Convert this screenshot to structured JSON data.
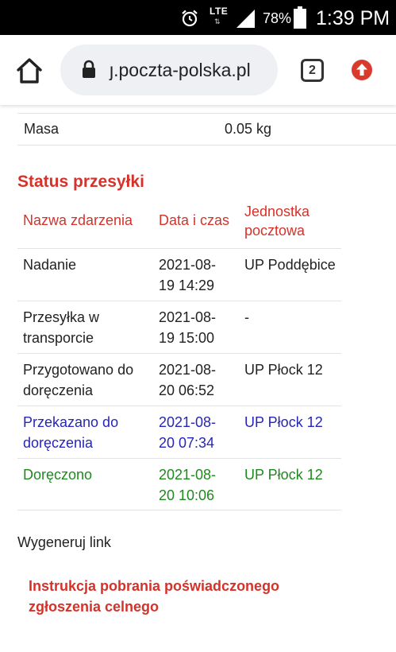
{
  "status_bar": {
    "network": "LTE",
    "network_arrows": "⇅",
    "battery": "78%",
    "time": "1:39 PM"
  },
  "browser": {
    "url": "ȷ.poczta-polska.pl",
    "tab_count": "2",
    "accent_update": "#d93a2b"
  },
  "shipment": {
    "mass_label": "Masa",
    "mass_value": "0.05 kg"
  },
  "status": {
    "title": "Status przesyłki",
    "columns": {
      "event": "Nazwa zdarzenia",
      "datetime": "Data i czas",
      "unit": "Jednostka pocztowa"
    },
    "rows": [
      {
        "event": "Nadanie",
        "datetime": "2021-08-19 14:29",
        "unit": "UP Poddębice"
      },
      {
        "event": "Przesyłka w transporcie",
        "datetime": "2021-08-19 15:00",
        "unit": "-"
      },
      {
        "event": "Przygotowano do doręczenia",
        "datetime": "2021-08-20 06:52",
        "unit": "UP Płock 12"
      },
      {
        "event": "Przekazano do doręczenia",
        "datetime": "2021-08-20 07:34",
        "unit": "UP Płock 12"
      },
      {
        "event": "Doręczono",
        "datetime": "2021-08-20 10:06",
        "unit": "UP Płock 12"
      }
    ]
  },
  "links": {
    "generate": "Wygeneruj link",
    "instruction": "Instrukcja pobrania poświadczonego zgłoszenia celnego"
  },
  "colors": {
    "heading_red": "#d5322a",
    "in_delivery_blue": "#2626b8",
    "delivered_green": "#1d8a1d"
  }
}
